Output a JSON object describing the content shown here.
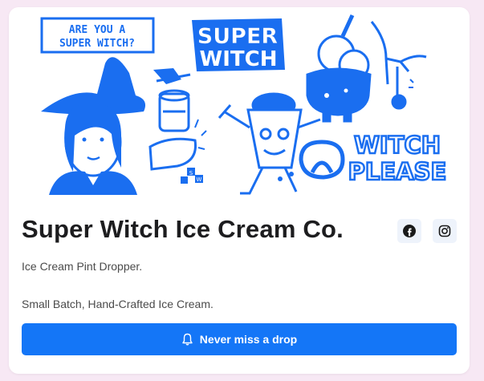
{
  "hero": {
    "question_line1": "ARE YOU A",
    "question_line2": "SUPER WITCH?",
    "logo_line1": "SUPER",
    "logo_line2": "WITCH",
    "tagline_line1": "WITCH",
    "tagline_line2": "PLEASE",
    "box_letters": [
      "S",
      "W"
    ],
    "ink_color": "#1a6ef0"
  },
  "business": {
    "name": "Super Witch Ice Cream Co.",
    "description_line1": "Ice Cream Pint Dropper.",
    "description_line2": "Small Batch, Hand-Crafted Ice Cream."
  },
  "social": [
    {
      "icon": "facebook-icon"
    },
    {
      "icon": "instagram-icon"
    }
  ],
  "cta": {
    "label": "Never miss a drop",
    "icon": "bell-icon",
    "color": "#1476f7"
  }
}
